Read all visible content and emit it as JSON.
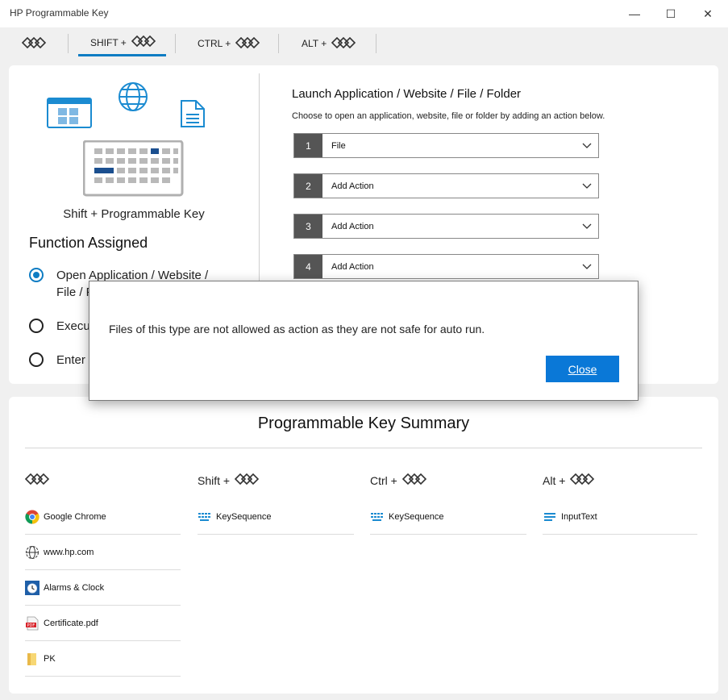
{
  "window": {
    "title": "HP Programmable Key",
    "controls": {
      "minimize": "—",
      "maximize": "☐",
      "close": "✕"
    }
  },
  "tabs": [
    {
      "label": "",
      "icon": "programmable-key-icon"
    },
    {
      "label": "SHIFT +",
      "icon": "programmable-key-icon",
      "active": true
    },
    {
      "label": "CTRL +",
      "icon": "programmable-key-icon"
    },
    {
      "label": "ALT +",
      "icon": "programmable-key-icon"
    }
  ],
  "left": {
    "key_label": "Shift + Programmable Key",
    "function_title": "Function Assigned",
    "options": [
      {
        "line1": "Open Application / Website /",
        "line2": "File / F",
        "checked": true
      },
      {
        "line1": "Execu",
        "checked": false
      },
      {
        "line1": "Enter",
        "checked": false
      }
    ]
  },
  "launch": {
    "title": "Launch Application / Website / File / Folder",
    "description": "Choose to open an application, website, file or folder by adding an action below.",
    "actions": [
      {
        "num": "1",
        "value": "File"
      },
      {
        "num": "2",
        "value": "Add Action"
      },
      {
        "num": "3",
        "value": "Add Action"
      },
      {
        "num": "4",
        "value": "Add Action"
      }
    ]
  },
  "summary": {
    "title": "Programmable Key Summary",
    "columns": [
      {
        "label": "",
        "items": [
          {
            "icon": "chrome-icon",
            "text": "Google Chrome"
          },
          {
            "icon": "web-icon",
            "text": "www.hp.com"
          },
          {
            "icon": "alarm-clock-icon",
            "text": "Alarms & Clock"
          },
          {
            "icon": "pdf-icon",
            "text": "Certificate.pdf"
          },
          {
            "icon": "folder-icon",
            "text": "PK"
          }
        ]
      },
      {
        "label": "Shift +",
        "items": [
          {
            "icon": "keyboard-icon",
            "text": "KeySequence"
          }
        ]
      },
      {
        "label": "Ctrl +",
        "items": [
          {
            "icon": "keyboard-icon",
            "text": "KeySequence"
          }
        ]
      },
      {
        "label": "Alt +",
        "items": [
          {
            "icon": "text-lines-icon",
            "text": "InputText"
          }
        ]
      }
    ]
  },
  "dialog": {
    "message": "Files of this type are not allowed as action as they are not safe for auto run.",
    "button": "Close"
  },
  "colors": {
    "accent": "#0e7cc3",
    "button": "#0a78d7",
    "number_box": "#555555"
  }
}
